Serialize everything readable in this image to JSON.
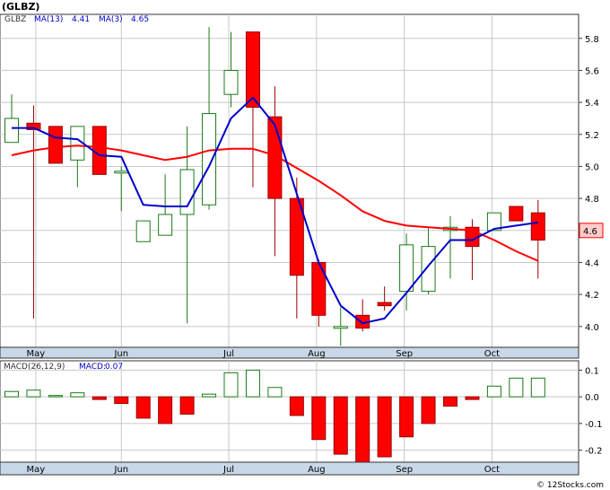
{
  "title": "(GLBZ)",
  "watermark": "© 12Stocks.com",
  "colors": {
    "up": "#1a7a1a",
    "down": "#ff0000",
    "ma13": "#ff0000",
    "ma3": "#0000cc",
    "grid": "#c8c8c8",
    "bar": "#c8d8e8",
    "price_box": "#ffcccc"
  },
  "chart_data": [
    {
      "type": "candlestick",
      "name": "price",
      "legend": {
        "symbol": "GLBZ",
        "ma13_label": "MA(13)",
        "ma13_value": "4.41",
        "ma3_label": "MA(3)",
        "ma3_value": "4.65"
      },
      "ylim": [
        3.87,
        5.95
      ],
      "yticks": [
        4.0,
        4.2,
        4.4,
        4.6,
        4.8,
        5.0,
        5.2,
        5.4,
        5.6,
        5.8
      ],
      "ytick_labels": [
        "4.0",
        "4.2",
        "4.4",
        "4.6",
        "4.8",
        "5.0",
        "5.2",
        "5.4",
        "5.6",
        "5.8"
      ],
      "last_price_label": "4.6",
      "last_price": 4.6,
      "months": [
        {
          "label": "May",
          "index": 1.1
        },
        {
          "label": "Jun",
          "index": 5.0
        },
        {
          "label": "Jul",
          "index": 9.9
        },
        {
          "label": "Aug",
          "index": 13.9
        },
        {
          "label": "Sep",
          "index": 17.9
        },
        {
          "label": "Oct",
          "index": 21.9
        }
      ],
      "candles": [
        {
          "o": 5.15,
          "h": 5.45,
          "l": 5.15,
          "c": 5.3
        },
        {
          "o": 5.27,
          "h": 5.38,
          "l": 4.05,
          "c": 5.23
        },
        {
          "o": 5.25,
          "h": 5.25,
          "l": 5.02,
          "c": 5.02
        },
        {
          "o": 5.04,
          "h": 5.25,
          "l": 4.87,
          "c": 5.25
        },
        {
          "o": 5.25,
          "h": 5.25,
          "l": 4.95,
          "c": 4.95
        },
        {
          "o": 4.97,
          "h": 5.0,
          "l": 4.72,
          "c": 4.97
        },
        {
          "o": 4.53,
          "h": 4.66,
          "l": 4.53,
          "c": 4.66
        },
        {
          "o": 4.57,
          "h": 4.95,
          "l": 4.57,
          "c": 4.7
        },
        {
          "o": 4.7,
          "h": 5.25,
          "l": 4.02,
          "c": 4.98
        },
        {
          "o": 4.76,
          "h": 5.87,
          "l": 4.73,
          "c": 5.33
        },
        {
          "o": 5.45,
          "h": 5.84,
          "l": 5.37,
          "c": 5.6
        },
        {
          "o": 5.84,
          "h": 5.84,
          "l": 4.87,
          "c": 5.37
        },
        {
          "o": 5.31,
          "h": 5.5,
          "l": 4.44,
          "c": 4.8
        },
        {
          "o": 4.8,
          "h": 4.93,
          "l": 4.05,
          "c": 4.32
        },
        {
          "o": 4.4,
          "h": 4.42,
          "l": 4.0,
          "c": 4.07
        },
        {
          "o": 4.0,
          "h": 4.12,
          "l": 3.88,
          "c": 4.0
        },
        {
          "o": 4.07,
          "h": 4.17,
          "l": 3.97,
          "c": 3.99
        },
        {
          "o": 4.15,
          "h": 4.25,
          "l": 4.1,
          "c": 4.13
        },
        {
          "o": 4.22,
          "h": 4.58,
          "l": 4.1,
          "c": 4.51
        },
        {
          "o": 4.22,
          "h": 4.62,
          "l": 4.2,
          "c": 4.5
        },
        {
          "o": 4.6,
          "h": 4.69,
          "l": 4.3,
          "c": 4.62
        },
        {
          "o": 4.62,
          "h": 4.67,
          "l": 4.29,
          "c": 4.5
        },
        {
          "o": 4.6,
          "h": 4.71,
          "l": 4.6,
          "c": 4.71
        },
        {
          "o": 4.75,
          "h": 4.75,
          "l": 4.66,
          "c": 4.66
        },
        {
          "o": 4.71,
          "h": 4.79,
          "l": 4.3,
          "c": 4.54
        }
      ],
      "ma13": [
        5.07,
        5.1,
        5.12,
        5.13,
        5.12,
        5.1,
        5.07,
        5.04,
        5.06,
        5.1,
        5.11,
        5.11,
        5.07,
        4.99,
        4.91,
        4.82,
        4.72,
        4.66,
        4.63,
        4.62,
        4.61,
        4.6,
        4.54,
        4.47,
        4.41
      ],
      "ma3": [
        5.24,
        5.24,
        5.18,
        5.17,
        5.07,
        5.06,
        4.76,
        4.75,
        4.75,
        5.0,
        5.3,
        5.43,
        5.26,
        4.83,
        4.4,
        4.13,
        4.02,
        4.05,
        4.21,
        4.38,
        4.54,
        4.54,
        4.61,
        4.63,
        4.65
      ]
    },
    {
      "type": "bar",
      "name": "macd",
      "legend": {
        "label": "MACD(26,12,9)",
        "value_label": "MACD:",
        "value": "0.07"
      },
      "ylim": [
        -0.245,
        0.135
      ],
      "yticks": [
        -0.2,
        -0.1,
        0.0,
        0.1
      ],
      "ytick_labels": [
        "-0.2",
        "-0.1",
        "0.0",
        "0.1"
      ],
      "values": [
        0.02,
        0.025,
        0.005,
        0.015,
        -0.01,
        -0.025,
        -0.08,
        -0.1,
        -0.065,
        0.01,
        0.09,
        0.1,
        0.035,
        -0.07,
        -0.16,
        -0.215,
        -0.245,
        -0.225,
        -0.15,
        -0.1,
        -0.035,
        -0.01,
        0.04,
        0.07,
        0.07
      ]
    }
  ]
}
